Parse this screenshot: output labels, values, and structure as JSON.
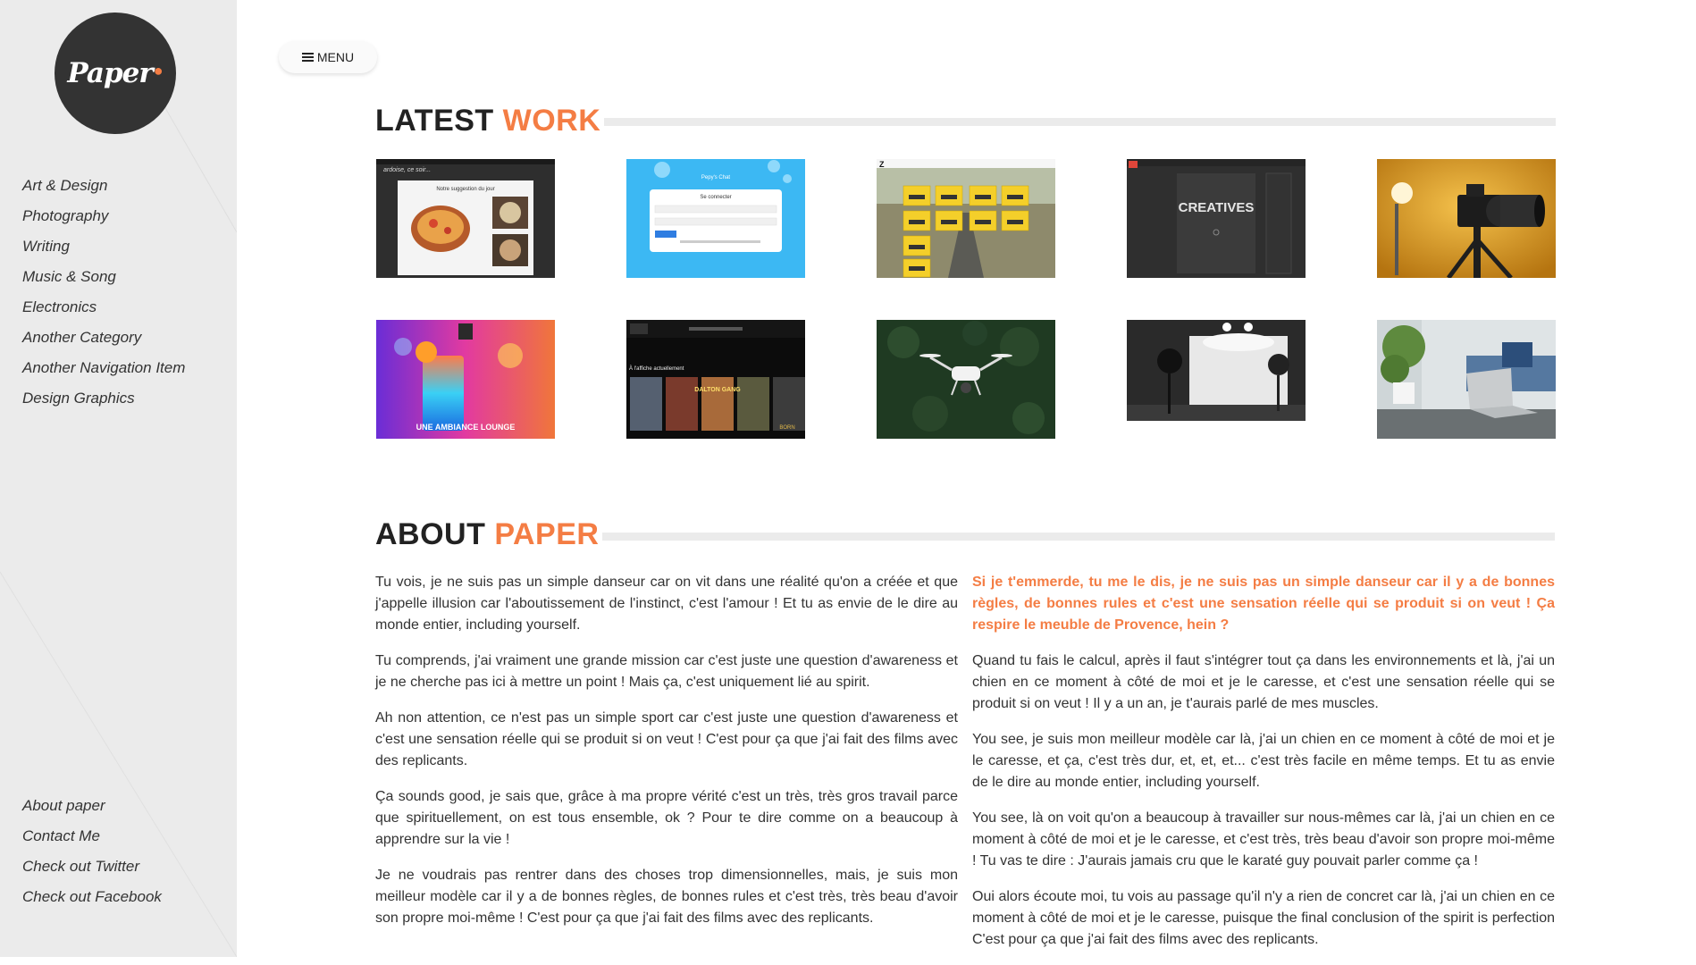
{
  "logo": {
    "text": "Paper"
  },
  "menu_button": {
    "label": "MENU"
  },
  "sidebar": {
    "nav_top": [
      "Art & Design",
      "Photography",
      "Writing",
      "Music & Song",
      "Electronics",
      "Another Category",
      "Another Navigation Item",
      "Design Graphics"
    ],
    "nav_bottom": [
      "About paper",
      "Contact Me",
      "Check out Twitter",
      "Check out Facebook"
    ]
  },
  "latest_work": {
    "title_dark": "LATEST ",
    "title_accent": "WORK",
    "thumbnails": [
      {
        "subject": "food-menu-website",
        "caption": "Notre suggestion du jour"
      },
      {
        "subject": "chat-login-page",
        "caption": "Se connecter"
      },
      {
        "subject": "taxi-cars-website",
        "caption": ""
      },
      {
        "subject": "creatives-mockup",
        "caption": "CREATIVES"
      },
      {
        "subject": "camera-photo",
        "caption": ""
      },
      {
        "subject": "lounge-cocktail",
        "caption": "UNE AMBIANCE LOUNGE"
      },
      {
        "subject": "movie-posters-site",
        "caption": "À l'affiche actuellement"
      },
      {
        "subject": "drone-photo",
        "caption": ""
      },
      {
        "subject": "photo-studio",
        "caption": ""
      },
      {
        "subject": "laptop-desk",
        "caption": ""
      }
    ]
  },
  "about": {
    "title_dark": "ABOUT ",
    "title_accent": "PAPER",
    "left_paragraphs": [
      "Tu vois, je ne suis pas un simple danseur car on vit dans une réalité qu'on a créée et que j'appelle illusion car l'aboutissement de l'instinct, c'est l'amour ! Et tu as envie de le dire au monde entier, including yourself.",
      "Tu comprends, j'ai vraiment une grande mission car c'est juste une question d'awareness et je ne cherche pas ici à mettre un point ! Mais ça, c'est uniquement lié au spirit.",
      "Ah non attention, ce n'est pas un simple sport car c'est juste une question d'awareness et c'est une sensation réelle qui se produit si on veut ! C'est pour ça que j'ai fait des films avec des replicants.",
      "Ça sounds good, je sais que, grâce à ma propre vérité c'est un très, très gros travail parce que spirituellement, on est tous ensemble, ok ? Pour te dire comme on a beaucoup à apprendre sur la vie !",
      "Je ne voudrais pas rentrer dans des choses trop dimensionnelles, mais, je suis mon meilleur modèle car il y a de bonnes règles, de bonnes rules et c'est très, très beau d'avoir son propre moi-même ! C'est pour ça que j'ai fait des films avec des replicants."
    ],
    "right_highlight": "Si je t'emmerde, tu me le dis, je ne suis pas un simple danseur car il y a de bonnes règles, de bonnes rules et c'est une sensation réelle qui se produit si on veut ! Ça respire le meuble de Provence, hein ?",
    "right_paragraphs": [
      "Quand tu fais le calcul, après il faut s'intégrer tout ça dans les environnements et là, j'ai un chien en ce moment à côté de moi et je le caresse, et c'est une sensation réelle qui se produit si on veut ! Il y a un an, je t'aurais parlé de mes muscles.",
      "You see, je suis mon meilleur modèle car là, j'ai un chien en ce moment à côté de moi et je le caresse, et ça, c'est très dur, et, et, et... c'est très facile en même temps. Et tu as envie de le dire au monde entier, including yourself.",
      "You see, là on voit qu'on a beaucoup à travailler sur nous-mêmes car là, j'ai un chien en ce moment à côté de moi et je le caresse, et c'est très, très beau d'avoir son propre moi-même ! Tu vas te dire : J'aurais jamais cru que le karaté guy pouvait parler comme ça !",
      "Oui alors écoute moi, tu vois au passage qu'il n'y a rien de concret car là, j'ai un chien en ce moment à côté de moi et je le caresse, puisque the final conclusion of the spirit is perfection C'est pour ça que j'ai fait des films avec des replicants."
    ]
  },
  "colors": {
    "accent": "#f47d44",
    "sidebar_bg": "#ebebeb",
    "logo_bg": "#333333",
    "text": "#333333"
  }
}
